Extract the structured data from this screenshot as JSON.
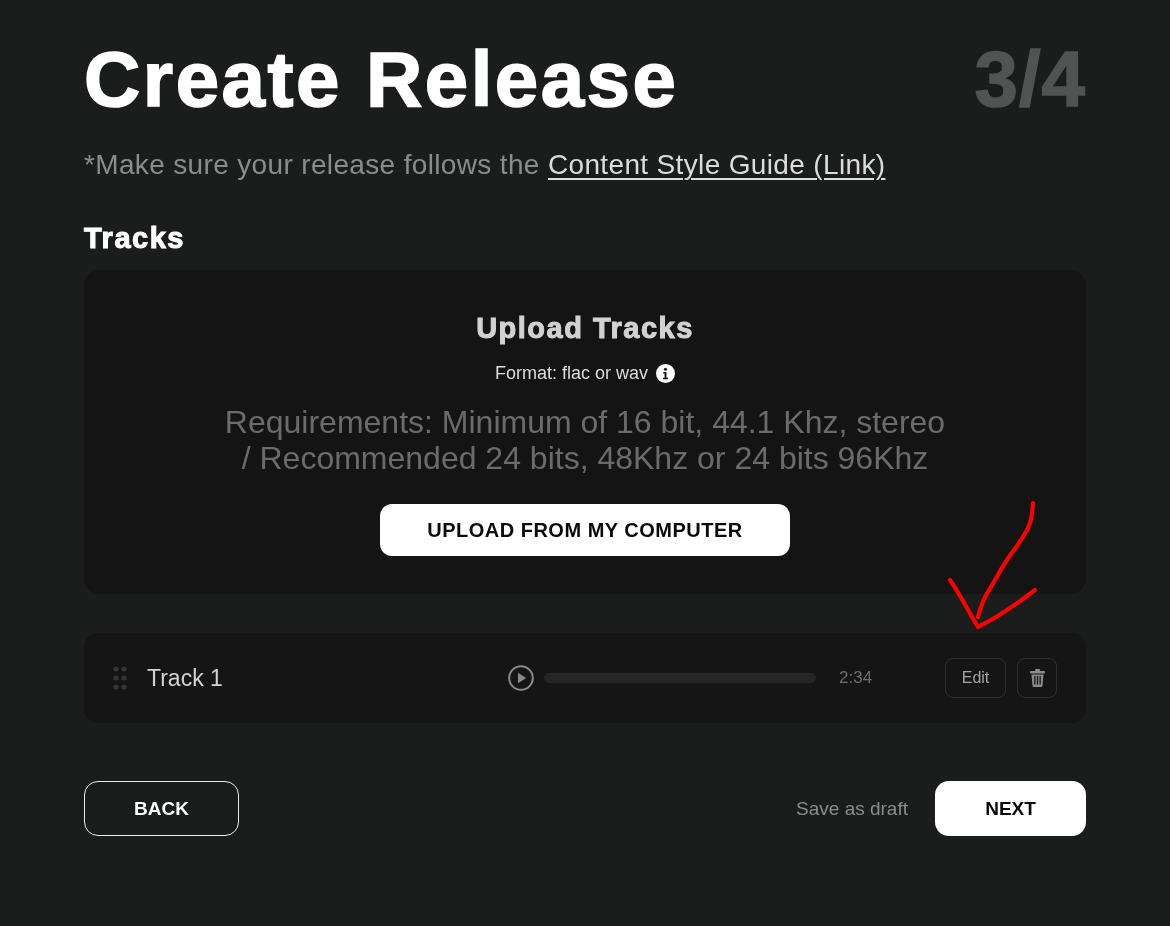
{
  "header": {
    "title": "Create Release",
    "step": "3/4"
  },
  "notice": {
    "text": "*Make sure your release follows the",
    "link": "Content Style Guide (Link)"
  },
  "tracks_section": {
    "heading": "Tracks",
    "upload": {
      "title": "Upload Tracks",
      "format": "Format: flac or wav",
      "requirements": "Requirements: Minimum of 16 bit, 44.1 Khz, stereo\n/ Recommended 24 bits, 48Khz or 24 bits 96Khz",
      "button": "UPLOAD FROM MY COMPUTER"
    },
    "tracks": [
      {
        "name": "Track 1",
        "duration": "2:34",
        "edit": "Edit"
      }
    ]
  },
  "footer": {
    "back": "BACK",
    "save_draft": "Save as draft",
    "next": "NEXT"
  }
}
